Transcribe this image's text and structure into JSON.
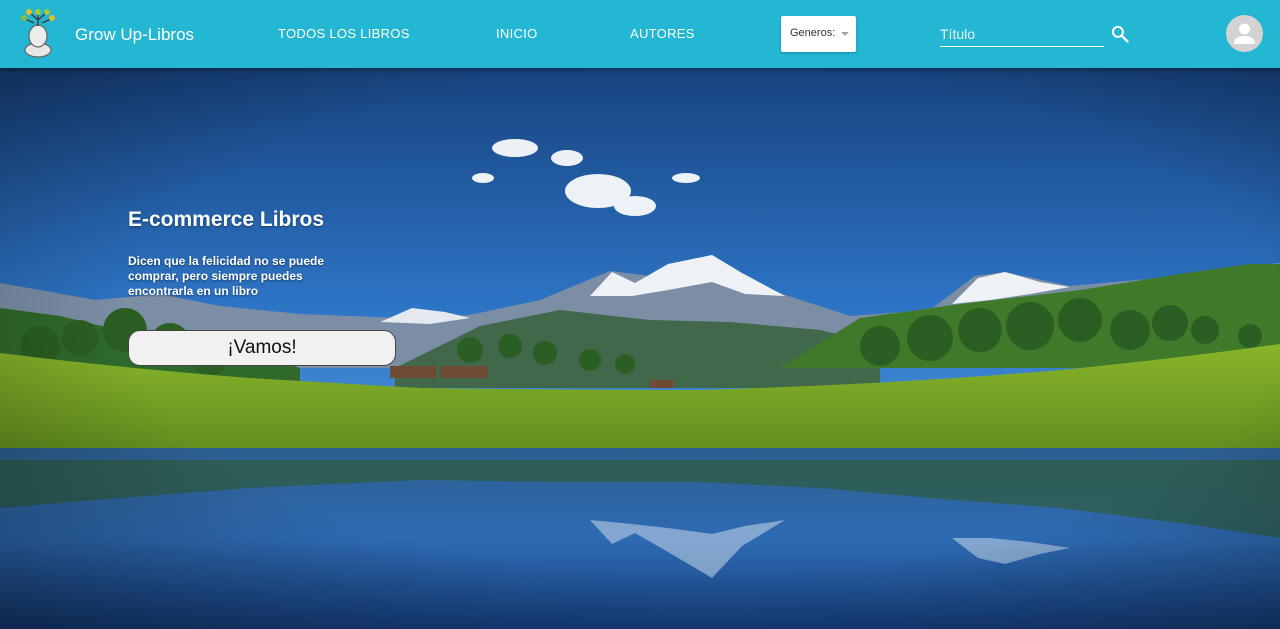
{
  "navbar": {
    "brand": "Grow Up-Libros",
    "links": [
      "TODOS LOS LIBROS",
      "INICIO",
      "AUTORES"
    ],
    "genre_select": {
      "selected": "Generos:"
    },
    "search": {
      "placeholder": "Título",
      "value": ""
    },
    "icons": {
      "logo": "tree-head-logo",
      "search": "search-icon",
      "avatar": "user-avatar-icon"
    }
  },
  "hero": {
    "title": "E-commerce Libros",
    "text": "Dicen que la felicidad no se puede comprar, pero siempre puedes encontrarla en un libro",
    "button": "¡Vamos!"
  },
  "colors": {
    "navbar": "#23b7d3",
    "brand_text": "#ffffff",
    "button_bg": "#f1f1f1"
  }
}
